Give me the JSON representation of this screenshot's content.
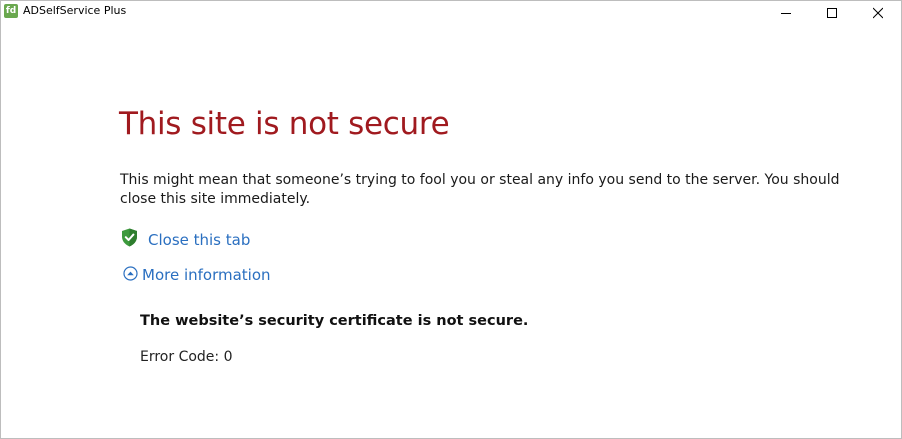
{
  "window": {
    "title": "ADSelfService Plus",
    "icon_glyph": "fd",
    "controls": {
      "minimize": "minimize-icon",
      "maximize": "maximize-icon",
      "close": "close-icon"
    }
  },
  "page": {
    "heading": "This site is not secure",
    "description": "This might mean that someone’s trying to fool you or steal any info you send to the server. You should close this site immediately.",
    "close_tab_label": "Close this tab",
    "more_info_label": "More information",
    "more_info_expanded": true,
    "cert_message": "The website’s security certificate is not secure.",
    "error_code": "Error Code: 0"
  },
  "colors": {
    "heading": "#a01a1f",
    "link": "#2a6fc0",
    "shield": "#3c9a3c",
    "app_icon": "#6aa84f"
  }
}
